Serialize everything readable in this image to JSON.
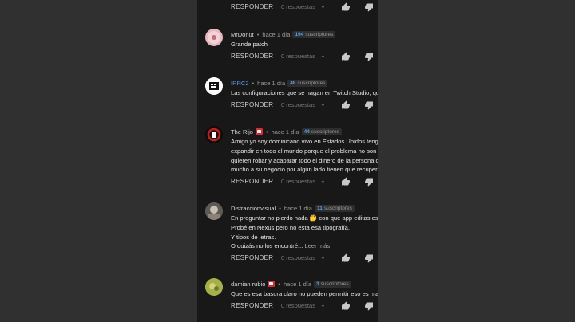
{
  "labels": {
    "reply": "RESPONDER",
    "replies": "0 respuestas",
    "subs_suffix": "suscriptores",
    "read_more": "Leer más"
  },
  "comments": [
    {
      "author": "MrDonut",
      "time": "hace 1 día",
      "subs": "194",
      "lines": [
        "Grande patch"
      ]
    },
    {
      "author": "IRRC2",
      "time": "hace 1 día",
      "subs": "48",
      "lines": [
        "Las configuraciones que se hagan en Twitch Studio, qued"
      ]
    },
    {
      "author": "The Rijo",
      "time": "hace 1 día",
      "subs": "44",
      "lines": [
        "Amigo yo soy dominicano vivo en Estados Unidos tengo u",
        "expandir en todo el mundo porque el problema no son lo",
        "quieren robar y acaparar todo el dinero de la persona com",
        "mucho a su negocio por algún lado tienen que recuperar e"
      ]
    },
    {
      "author": "Distraccionvisual",
      "time": "hace 1 día",
      "subs": "11",
      "lines": [
        "En preguntar no pierdo nada 🤔 con que app editas estos",
        "Probé en Nexus pero no esta esa tipografía.",
        "Y tipos de letras.",
        "O quizás no los encontré..."
      ]
    },
    {
      "author": "damian rubio",
      "time": "hace 1 día",
      "subs": "3",
      "lines": [
        "Que es esa basura claro no pueden permitir eso es manip"
      ]
    }
  ]
}
